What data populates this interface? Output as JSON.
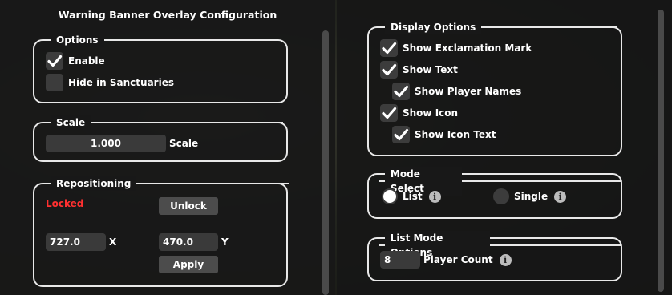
{
  "left_window": {
    "title": "Warning Banner Overlay Configuration",
    "options": {
      "legend": "Options",
      "enable": {
        "label": "Enable",
        "checked": true
      },
      "hide_in_sanctuaries": {
        "label": "Hide in Sanctuaries",
        "checked": false
      }
    },
    "scale": {
      "legend": "Scale",
      "value": "1.000",
      "label": "Scale"
    },
    "repositioning": {
      "legend": "Repositioning",
      "status": "Locked",
      "status_color": "#ff3030",
      "unlock_label": "Unlock",
      "x_value": "727.0",
      "x_label": "X",
      "y_value": "470.0",
      "y_label": "Y",
      "apply_label": "Apply"
    }
  },
  "right_window": {
    "display_options": {
      "legend": "Display Options",
      "show_exclamation": {
        "label": "Show Exclamation Mark",
        "checked": true
      },
      "show_text": {
        "label": "Show Text",
        "checked": true
      },
      "show_player_names": {
        "label": "Show Player Names",
        "checked": true
      },
      "show_icon": {
        "label": "Show Icon",
        "checked": true
      },
      "show_icon_text": {
        "label": "Show Icon Text",
        "checked": true
      }
    },
    "mode_select": {
      "legend": "Mode Select",
      "list_label": "List",
      "single_label": "Single",
      "selected": "List",
      "info_icon": "i"
    },
    "list_mode_options": {
      "legend": "List Mode Options",
      "player_count_value": "8",
      "player_count_label": "Player Count",
      "info_icon": "i"
    }
  }
}
